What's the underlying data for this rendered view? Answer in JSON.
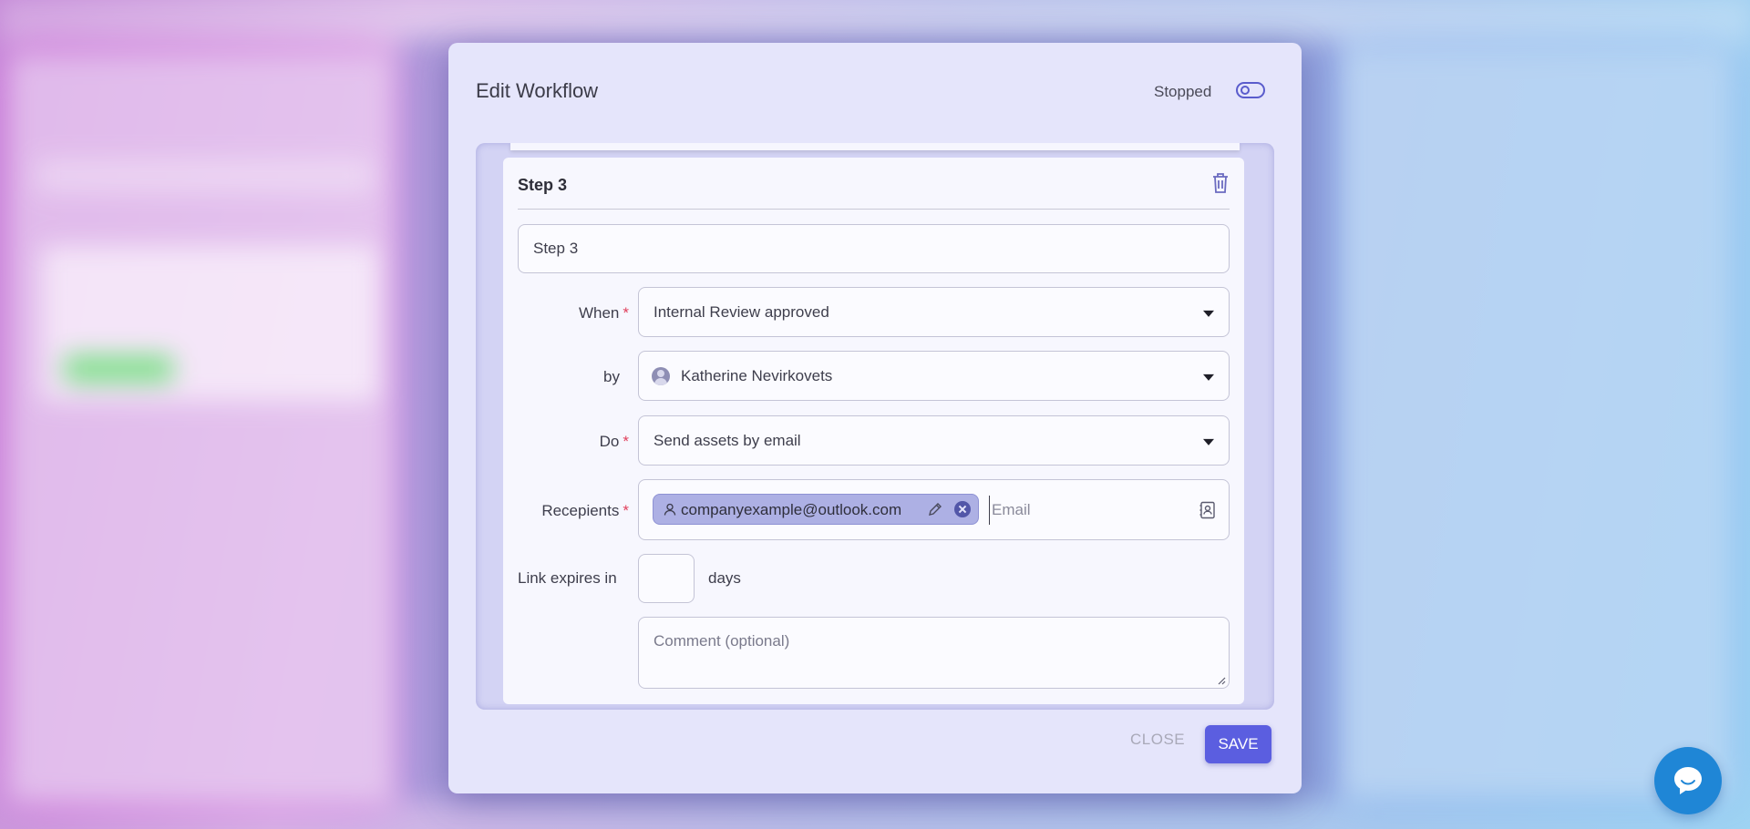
{
  "modal": {
    "title": "Edit Workflow",
    "status_label": "Stopped",
    "toggle_on": false
  },
  "step": {
    "title": "Step 3",
    "name_value": "Step 3",
    "when_label": "When",
    "when_value": "Internal Review approved",
    "by_label": "by",
    "by_value": "Katherine Nevirkovets",
    "do_label": "Do",
    "do_value": "Send assets by email",
    "recipients_label": "Recepients",
    "recipient_chip": "companyexample@outlook.com",
    "email_placeholder": "Email",
    "link_expires_label": "Link expires in",
    "days_value": "",
    "days_unit": "days",
    "comment_placeholder": "Comment (optional)",
    "required_mark": "*"
  },
  "footer": {
    "close_label": "CLOSE",
    "save_label": "SAVE"
  },
  "colors": {
    "accent": "#5b5ee0",
    "chip_bg": "#adb0e4",
    "chat": "#1f86d6",
    "required": "#e0405c"
  },
  "icons": [
    "toggle-icon",
    "trash-icon",
    "avatar-icon",
    "chevron-down-icon",
    "user-icon",
    "pencil-icon",
    "close-circle-icon",
    "contacts-icon",
    "resize-grip-icon",
    "chat-icon"
  ]
}
